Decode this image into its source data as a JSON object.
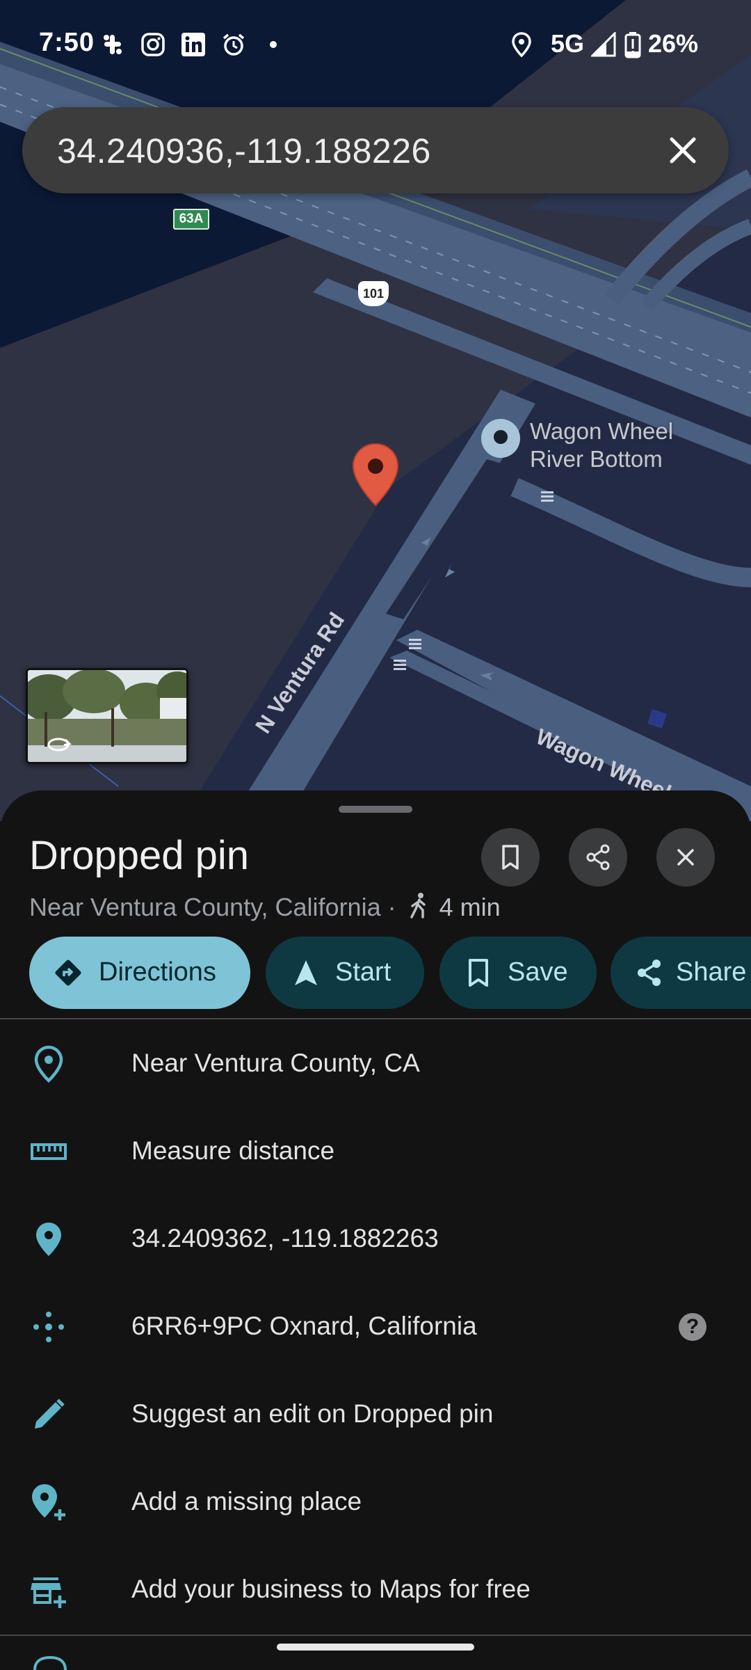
{
  "status_bar": {
    "time": "7:50",
    "network": "5G",
    "battery": "26%",
    "left_icons": [
      "slack-icon",
      "instagram-icon",
      "linkedin-icon",
      "alarm-icon",
      "dot-icon"
    ],
    "right_icons": [
      "location-icon",
      "signal-icon",
      "battery-icon"
    ]
  },
  "search": {
    "query": "34.240936,-119.188226",
    "clear_icon": "close-icon"
  },
  "map": {
    "labels": {
      "poi": "Wagon Wheel River Bottom",
      "road_1": "N Ventura Rd",
      "road_2": "Wagon Wheel Rd",
      "exit_shield": "63A",
      "highway_shield": "101"
    },
    "pin_color": "#e35a43",
    "poi_marker_color": "#a7c4d8"
  },
  "sheet": {
    "title": "Dropped pin",
    "subtitle_place": "Near Ventura County, California",
    "subtitle_separator": "·",
    "walk_time": "4 min",
    "icon_buttons": [
      "bookmark-icon",
      "share-icon",
      "close-icon"
    ],
    "chips": [
      {
        "label": "Directions",
        "icon": "directions-icon",
        "primary": true
      },
      {
        "label": "Start",
        "icon": "navigation-arrow-icon",
        "primary": false
      },
      {
        "label": "Save",
        "icon": "bookmark-icon",
        "primary": false
      },
      {
        "label": "Share",
        "icon": "share-icon",
        "primary": false
      }
    ],
    "rows": [
      {
        "text": "Near Ventura County, CA",
        "icon": "location-outline-icon"
      },
      {
        "text": "Measure distance",
        "icon": "ruler-icon"
      },
      {
        "text": "34.2409362, -119.1882263",
        "icon": "location-pin-icon"
      },
      {
        "text": "6RR6+9PC Oxnard, California",
        "icon": "plus-code-icon",
        "help": "?"
      },
      {
        "text": "Suggest an edit on Dropped pin",
        "icon": "pencil-icon"
      },
      {
        "text": "Add a missing place",
        "icon": "add-location-icon"
      },
      {
        "text": "Add your business to Maps for free",
        "icon": "add-business-icon"
      }
    ]
  },
  "colors": {
    "accent": "#7fc4d6",
    "chip_bg": "#0f3942",
    "chip_text": "#b7e6ef",
    "sheet_bg": "#131314",
    "icon_teal": "#5fb4c8"
  }
}
